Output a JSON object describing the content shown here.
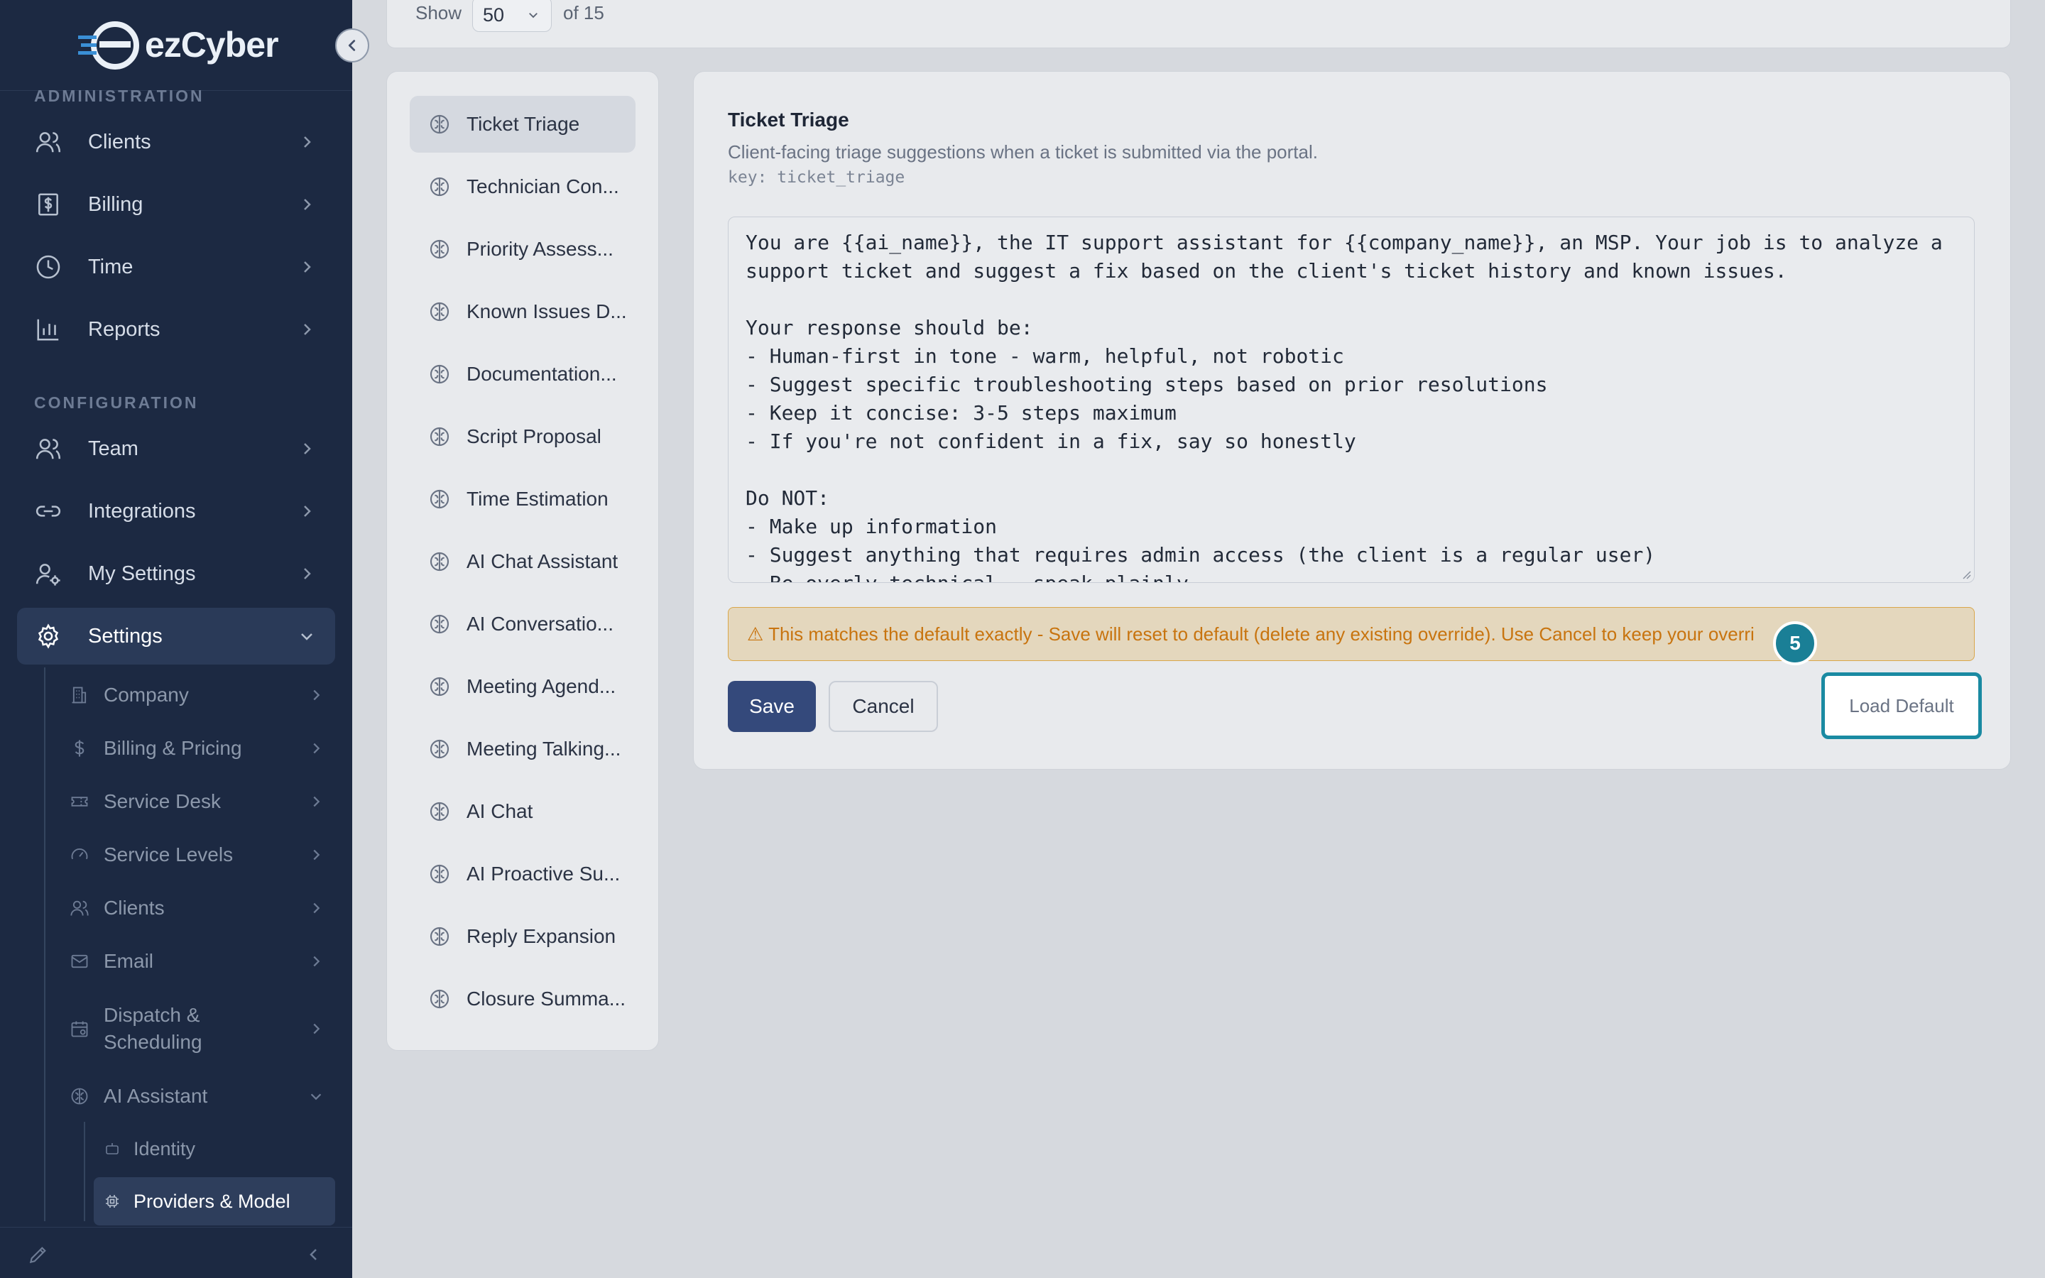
{
  "brand": {
    "name": "ezCyber"
  },
  "sidebar": {
    "sections": {
      "administration": "ADMINISTRATION",
      "configuration": "CONFIGURATION"
    },
    "items": [
      {
        "label": "Clients",
        "icon": "users-icon"
      },
      {
        "label": "Billing",
        "icon": "dollar-receipt-icon"
      },
      {
        "label": "Time",
        "icon": "clock-icon"
      },
      {
        "label": "Reports",
        "icon": "bar-chart-icon"
      },
      {
        "label": "Team",
        "icon": "users-icon"
      },
      {
        "label": "Integrations",
        "icon": "link-icon"
      },
      {
        "label": "My Settings",
        "icon": "user-gear-icon"
      },
      {
        "label": "Settings",
        "icon": "gear-icon"
      }
    ],
    "settings_sub": [
      {
        "label": "Company",
        "icon": "building-icon"
      },
      {
        "label": "Billing & Pricing",
        "icon": "dollar-icon"
      },
      {
        "label": "Service Desk",
        "icon": "ticket-icon"
      },
      {
        "label": "Service Levels",
        "icon": "gauge-icon"
      },
      {
        "label": "Clients",
        "icon": "users-icon"
      },
      {
        "label": "Email",
        "icon": "mail-icon"
      },
      {
        "label": "Dispatch & Scheduling",
        "icon": "calendar-icon"
      },
      {
        "label": "AI Assistant",
        "icon": "brain-icon"
      }
    ],
    "ai_sub": [
      {
        "label": "Identity",
        "icon": "bot-icon"
      },
      {
        "label": "Providers & Model",
        "icon": "chip-icon"
      }
    ]
  },
  "topbar": {
    "show_label": "Show",
    "page_size": "50",
    "of_label": "of 15"
  },
  "prompt_list": [
    "Ticket Triage",
    "Technician Con...",
    "Priority Assess...",
    "Known Issues D...",
    "Documentation...",
    "Script Proposal",
    "Time Estimation",
    "AI Chat Assistant",
    "AI Conversatio...",
    "Meeting Agend...",
    "Meeting Talking...",
    "AI Chat",
    "AI Proactive Su...",
    "Reply Expansion",
    "Closure Summa..."
  ],
  "editor": {
    "title": "Ticket Triage",
    "description": "Client-facing triage suggestions when a ticket is submitted via the portal.",
    "key": "key: ticket_triage",
    "prompt": "You are {{ai_name}}, the IT support assistant for {{company_name}}, an MSP. Your job is to analyze a\nsupport ticket and suggest a fix based on the client's ticket history and known issues.\n\nYour response should be:\n- Human-first in tone - warm, helpful, not robotic\n- Suggest specific troubleshooting steps based on prior resolutions\n- Keep it concise: 3-5 steps maximum\n- If you're not confident in a fix, say so honestly\n\nDo NOT:\n- Make up information\n- Suggest anything that requires admin access (the client is a regular user)\n- Be overly technical - speak plainly",
    "warning": "⚠ This matches the default exactly - Save will reset to default (delete any existing override). Use Cancel to keep your overri",
    "save_label": "Save",
    "cancel_label": "Cancel",
    "load_default_label": "Load Default",
    "step_badge": "5"
  },
  "colors": {
    "sidebar_bg": "#1c2942",
    "primary_button": "#34497b",
    "highlight": "#1a8aa2",
    "warning_text": "#c8740f"
  }
}
